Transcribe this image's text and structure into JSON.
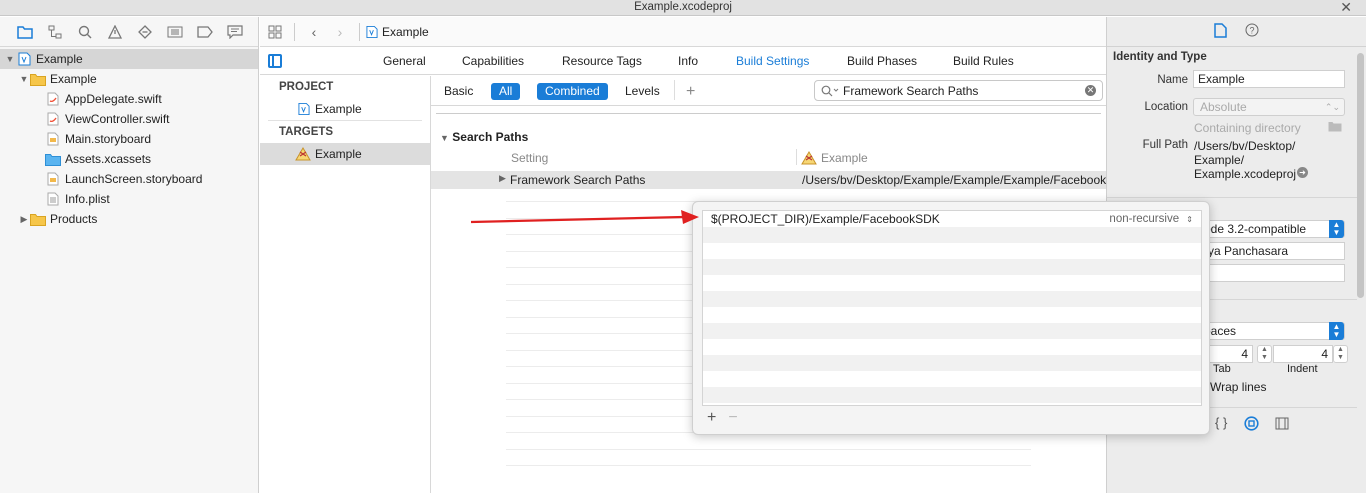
{
  "window": {
    "title": "Example.xcodeproj"
  },
  "navigator": {
    "tree": [
      {
        "label": "Example",
        "level": 0,
        "kind": "project",
        "expanded": true,
        "selected": true
      },
      {
        "label": "Example",
        "level": 1,
        "kind": "folder",
        "expanded": true
      },
      {
        "label": "AppDelegate.swift",
        "level": 2,
        "kind": "swift"
      },
      {
        "label": "ViewController.swift",
        "level": 2,
        "kind": "swift"
      },
      {
        "label": "Main.storyboard",
        "level": 2,
        "kind": "storyboard"
      },
      {
        "label": "Assets.xcassets",
        "level": 2,
        "kind": "assets"
      },
      {
        "label": "LaunchScreen.storyboard",
        "level": 2,
        "kind": "storyboard"
      },
      {
        "label": "Info.plist",
        "level": 2,
        "kind": "plist"
      },
      {
        "label": "Products",
        "level": 1,
        "kind": "folder",
        "expanded": false
      }
    ]
  },
  "jumpbar": {
    "crumb": "Example"
  },
  "tabs": [
    "General",
    "Capabilities",
    "Resource Tags",
    "Info",
    "Build Settings",
    "Build Phases",
    "Build Rules"
  ],
  "active_tab": "Build Settings",
  "targets_pane": {
    "project_header": "PROJECT",
    "project_item": "Example",
    "targets_header": "TARGETS",
    "target_item": "Example"
  },
  "filter": {
    "basic": "Basic",
    "all": "All",
    "combined": "Combined",
    "levels": "Levels",
    "add": "+",
    "search_value": "Framework Search Paths"
  },
  "build_settings": {
    "section": "Search Paths",
    "col_setting": "Setting",
    "col_target": "Example",
    "row_name": "Framework Search Paths",
    "row_value": "/Users/bv/Desktop/Example/Example/Example/FacebookSDK"
  },
  "popover": {
    "path": "$(PROJECT_DIR)/Example/FacebookSDK",
    "recursive": "non-recursive",
    "add": "+",
    "remove": "−"
  },
  "inspector": {
    "section": "Identity and Type",
    "name_label": "Name",
    "name_value": "Example",
    "location_label": "Location",
    "location_value": "Absolute",
    "containing_dir": "Containing directory",
    "fullpath_label": "Full Path",
    "fullpath_line1": "/Users/bv/Desktop/",
    "fullpath_line2": "Example/",
    "fullpath_line3": "Example.xcodeproj",
    "compat_value": "ode 3.2-compatible",
    "org_value": "sya Panchasara",
    "indent_using": "paces",
    "tab_value": "4",
    "indent_value": "4",
    "tab_label": "Tab",
    "indent_label": "Indent",
    "wrap_label": "Wrap lines"
  },
  "colors": {
    "accent": "#1a7dd7",
    "arrow": "#e02020"
  }
}
